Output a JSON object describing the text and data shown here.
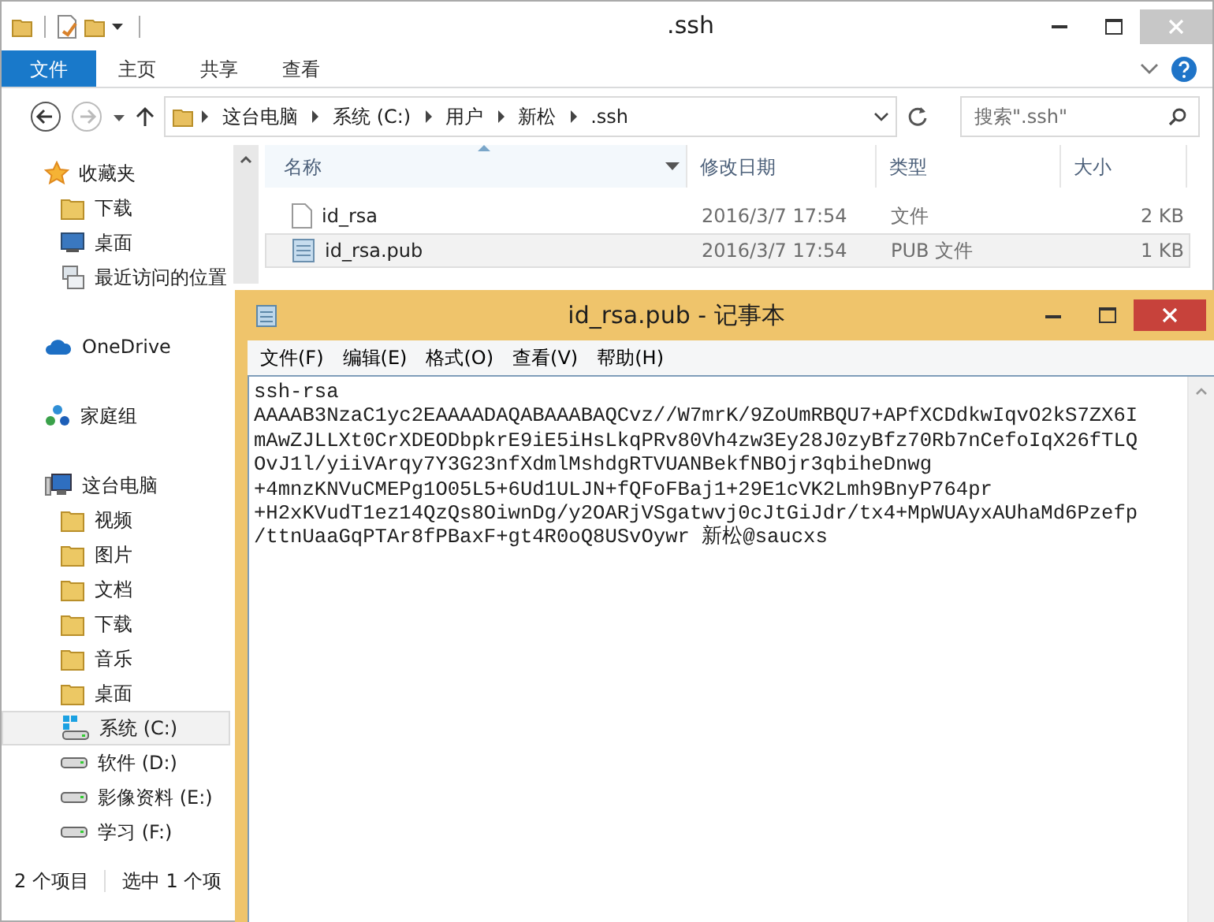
{
  "explorer": {
    "title": ".ssh",
    "ribbon_tabs": [
      {
        "label": "文件",
        "selected": true
      },
      {
        "label": "主页",
        "selected": false
      },
      {
        "label": "共享",
        "selected": false
      },
      {
        "label": "查看",
        "selected": false
      }
    ],
    "address": {
      "path": [
        "这台电脑",
        "系统 (C:)",
        "用户",
        "新松",
        ".ssh"
      ]
    },
    "search": {
      "placeholder": "搜索\".ssh\""
    },
    "nav": [
      {
        "label": "收藏夹",
        "kind": "star",
        "selected": false,
        "children": [
          {
            "label": "下载",
            "kind": "folder",
            "selected": false
          },
          {
            "label": "桌面",
            "kind": "desktop",
            "selected": false
          },
          {
            "label": "最近访问的位置",
            "kind": "recent",
            "selected": false
          }
        ]
      },
      {
        "label": "OneDrive",
        "kind": "cloud",
        "selected": false
      },
      {
        "label": "家庭组",
        "kind": "homegroup",
        "selected": false
      },
      {
        "label": "这台电脑",
        "kind": "computer",
        "selected": false,
        "children": [
          {
            "label": "视频",
            "kind": "folder",
            "selected": false
          },
          {
            "label": "图片",
            "kind": "folder",
            "selected": false
          },
          {
            "label": "文档",
            "kind": "folder",
            "selected": false
          },
          {
            "label": "下载",
            "kind": "folder",
            "selected": false
          },
          {
            "label": "音乐",
            "kind": "folder",
            "selected": false
          },
          {
            "label": "桌面",
            "kind": "folder",
            "selected": false
          },
          {
            "label": "系统 (C:)",
            "kind": "system-drive",
            "selected": true
          },
          {
            "label": "软件 (D:)",
            "kind": "drive",
            "selected": false
          },
          {
            "label": "影像资料 (E:)",
            "kind": "drive",
            "selected": false
          },
          {
            "label": "学习 (F:)",
            "kind": "drive",
            "selected": false
          }
        ]
      }
    ],
    "columns": [
      "名称",
      "修改日期",
      "类型",
      "大小"
    ],
    "files": [
      {
        "name": "id_rsa",
        "modified": "2016/3/7 17:54",
        "type": "文件",
        "size": "2 KB",
        "kind": "file",
        "selected": false
      },
      {
        "name": "id_rsa.pub",
        "modified": "2016/3/7 17:54",
        "type": "PUB 文件",
        "size": "1 KB",
        "kind": "text",
        "selected": true
      }
    ],
    "status_bar": [
      "2 个项目",
      "选中 1 个项"
    ]
  },
  "notepad": {
    "title": "id_rsa.pub - 记事本",
    "menu": [
      "文件(F)",
      "编辑(E)",
      "格式(O)",
      "查看(V)",
      "帮助(H)"
    ],
    "lines": [
      "ssh-rsa",
      "AAAAB3NzaC1yc2EAAAADAQABAAABAQCvz//W7mrK/9ZoUmRBQU7+APfXCDdkwIqvO2kS7ZX6I",
      "mAwZJLLXt0CrXDEODbpkrE9iE5iHsLkqPRv80Vh4zw3Ey28J0zyBfz70Rb7nCefoIqX26fTLQ",
      "OvJ1l/yiiVArqy7Y3G23nfXdmlMshdgRTVUANBekfNBOjr3qbiheDnwg",
      "+4mnzKNVuCMEPg1O05L5+6Ud1ULJN+fQFoFBaj1+29E1cVK2Lmh9BnyP764pr",
      "+H2xKVudT1ez14QzQs8OiwnDg/y2OARjVSgatwvj0cJtGiJdr/tx4+MpWUAyxAUhaMd6Pzefp",
      "/ttnUaaGqPTAr8fPBaxF+gt4R0oQ8USvOywr 新松@saucxs"
    ]
  }
}
